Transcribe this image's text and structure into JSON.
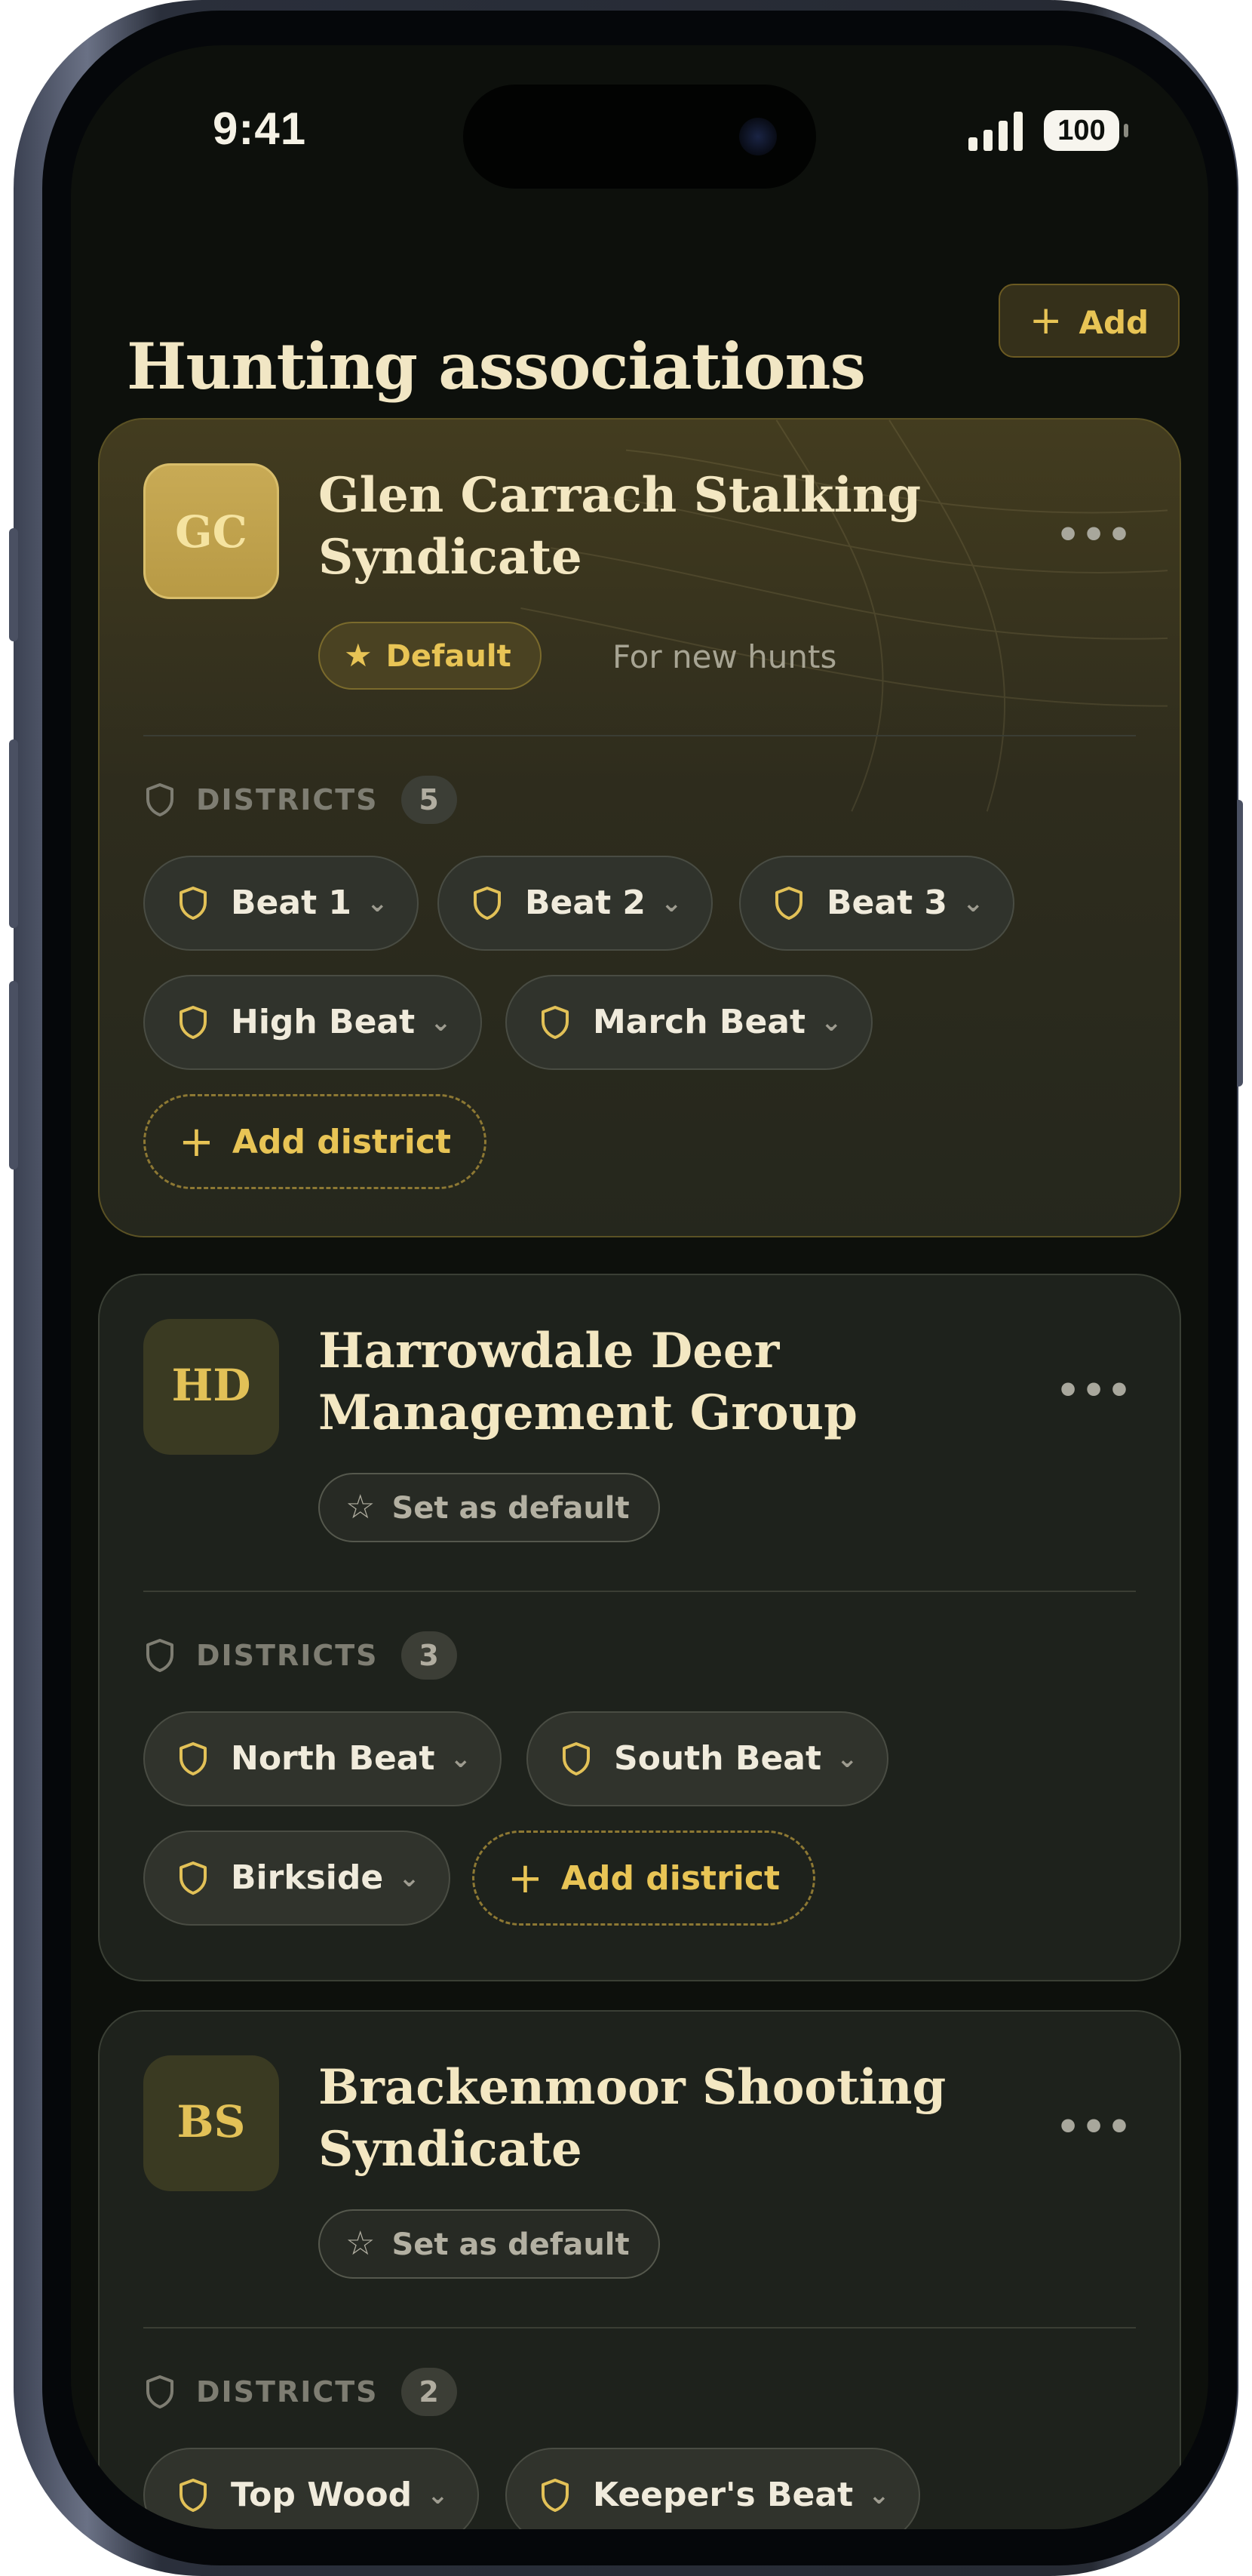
{
  "status": {
    "time": "9:41",
    "battery": "100"
  },
  "header": {
    "title": "Hunting associations",
    "add_label": "Add"
  },
  "associations": [
    {
      "initials": "GC",
      "name": "Glen Carrach Stalking Syndicate",
      "default_label": "Default",
      "default_note": "For new hunts",
      "districts_label": "DISTRICTS",
      "district_count": "5",
      "districts": [
        "Beat 1",
        "Beat 2",
        "Beat 3",
        "High Beat",
        "March Beat"
      ],
      "add_district": "Add district"
    },
    {
      "initials": "HD",
      "name": "Harrowdale Deer Management Group",
      "set_default_label": "Set as default",
      "districts_label": "DISTRICTS",
      "district_count": "3",
      "districts": [
        "North Beat",
        "South Beat",
        "Birkside"
      ],
      "add_district": "Add district"
    },
    {
      "initials": "BS",
      "name": "Brackenmoor Shooting Syndicate",
      "set_default_label": "Set as default",
      "districts_label": "DISTRICTS",
      "district_count": "2",
      "districts": [
        "Top Wood",
        "Keeper's Beat"
      ]
    }
  ],
  "colors": {
    "accent": "#e8c455",
    "background": "#0d100c",
    "card": "#1e221c"
  }
}
